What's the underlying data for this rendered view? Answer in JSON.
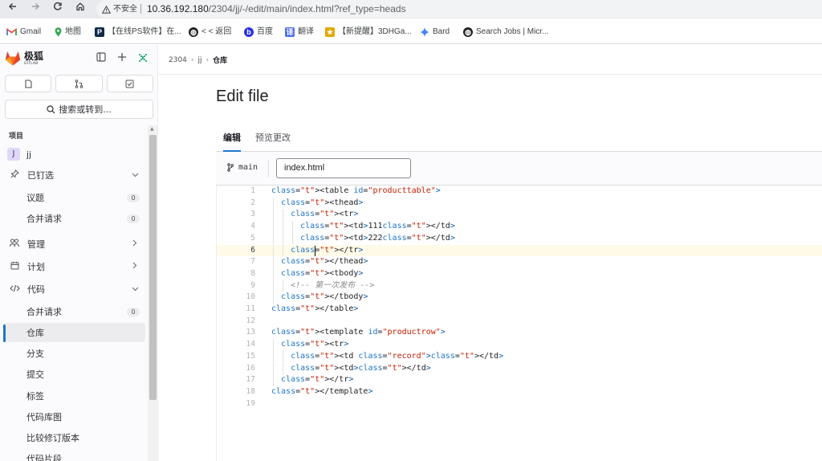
{
  "browser": {
    "security_label": "不安全",
    "url_host": "10.36.192.180",
    "url_path": "/2304/jj/-/edit/main/index.html?ref_type=heads",
    "bookmarks": [
      {
        "label": "Gmail",
        "icon": "gmail-icon",
        "color": "#ea4335"
      },
      {
        "label": "地图",
        "icon": "maps-icon",
        "color": "#34a853"
      },
      {
        "label": "【在线PS软件】在...",
        "icon": "ps-icon",
        "color": "#0f2a4a"
      },
      {
        "label": "< < 返回",
        "icon": "globe-icon",
        "color": "#202124"
      },
      {
        "label": "百度",
        "icon": "baidu-icon",
        "color": "#2932e1"
      },
      {
        "label": "翻译",
        "icon": "translate-icon",
        "color": "#4e6ef2"
      },
      {
        "label": "【新提醒】3DHGa...",
        "icon": "forum-icon",
        "color": "#e0a800"
      },
      {
        "label": "Bard",
        "icon": "bard-icon",
        "color": "#4285f4"
      },
      {
        "label": "Search Jobs | Micr...",
        "icon": "globe-icon",
        "color": "#202124"
      }
    ]
  },
  "sidebar": {
    "brand": "极狐",
    "brand_sub": "GITLAB",
    "search_label": "搜索或转到...",
    "section_title": "项目",
    "project": {
      "avatar": "J",
      "name": "jj"
    },
    "items": [
      {
        "label": "已钉选",
        "icon": "pin-icon",
        "chevron": "⌄"
      },
      {
        "label": "议题",
        "count": "0"
      },
      {
        "label": "合并请求",
        "count": "0"
      },
      {
        "label": "管理",
        "icon": "users-icon",
        "chevron": "›"
      },
      {
        "label": "计划",
        "icon": "calendar-icon",
        "chevron": "›"
      },
      {
        "label": "代码",
        "icon": "code-icon",
        "chevron": "⌄"
      },
      {
        "label": "合并请求",
        "count": "0"
      },
      {
        "label": "仓库",
        "active": true
      },
      {
        "label": "分支"
      },
      {
        "label": "提交"
      },
      {
        "label": "标签"
      },
      {
        "label": "代码库图"
      },
      {
        "label": "比较修订版本"
      },
      {
        "label": "代码片段"
      }
    ]
  },
  "breadcrumb": [
    "2304",
    "jj",
    "仓库"
  ],
  "page_title": "Edit file",
  "tabs": [
    {
      "label": "编辑",
      "active": true
    },
    {
      "label": "预览更改",
      "active": false
    }
  ],
  "editor": {
    "branch": "main",
    "file_name": "index.html",
    "current_line": 6,
    "line_numbers": [
      "1",
      "2",
      "3",
      "4",
      "5",
      "6",
      "7",
      "8",
      "9",
      "10",
      "11",
      "12",
      "13",
      "14",
      "15",
      "16",
      "17",
      "18",
      "19"
    ],
    "lines": [
      "<table id=\"producttable\">",
      "  <thead>",
      "    <tr>",
      "      <td>111</td>",
      "      <td>222</td>",
      "    </tr>",
      "  </thead>",
      "  <tbody>",
      "    <!-- 第一次发布 -->",
      "  </tbody>",
      "</table>",
      "",
      "<template id=\"productrow\">",
      "  <tr>",
      "    <td class=\"record\"></td>",
      "    <td></td>",
      "  </tr>",
      "</template>",
      ""
    ]
  }
}
